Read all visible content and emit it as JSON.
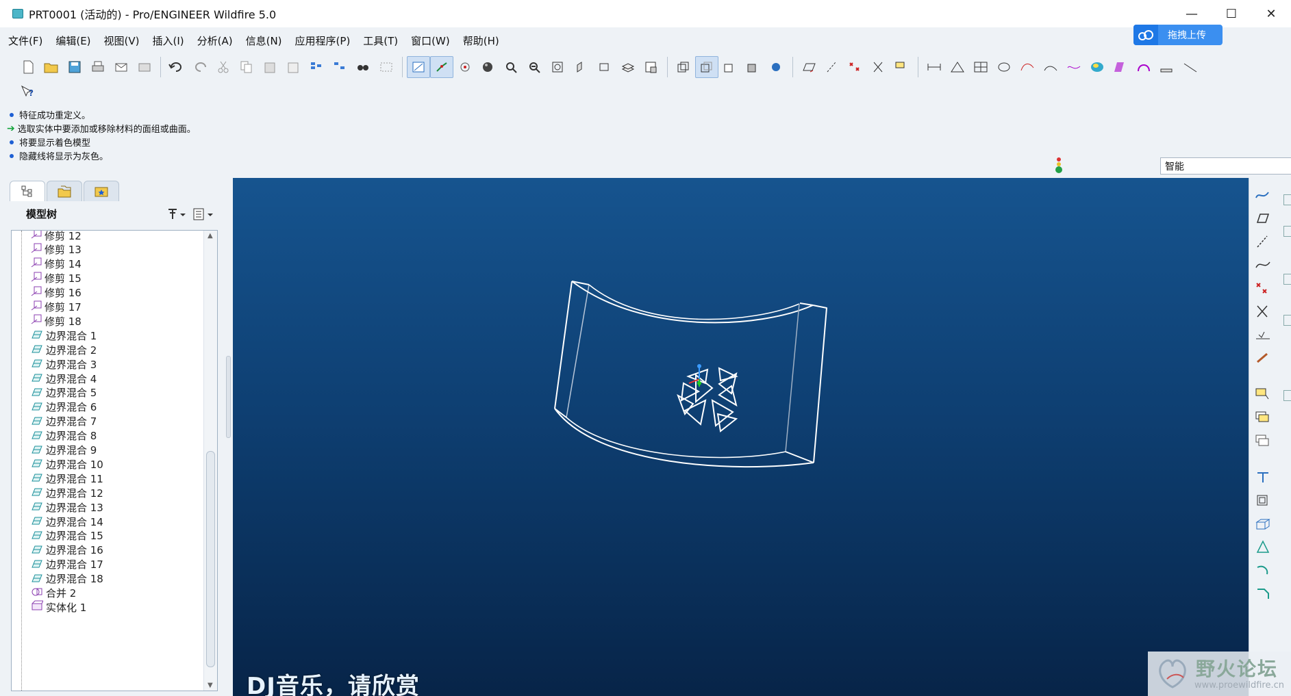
{
  "window": {
    "title": "PRT0001 (活动的) - Pro/ENGINEER Wildfire 5.0",
    "controls": [
      "—",
      "☐",
      "✕"
    ]
  },
  "menubar": {
    "items": [
      "文件(F)",
      "编辑(E)",
      "视图(V)",
      "插入(I)",
      "分析(A)",
      "信息(N)",
      "应用程序(P)",
      "工具(T)",
      "窗口(W)",
      "帮助(H)"
    ]
  },
  "cloud_upload": {
    "label": "拖拽上传"
  },
  "messages": [
    {
      "type": "info",
      "text": "特征成功重定义。"
    },
    {
      "type": "prompt",
      "text": "选取实体中要添加或移除材料的面组或曲面。"
    },
    {
      "type": "info",
      "text": "将要显示着色模型"
    },
    {
      "type": "info",
      "text": "隐藏线将显示为灰色。"
    }
  ],
  "selection_filter": {
    "value": "智能"
  },
  "model_tree": {
    "title": "模型树",
    "items": [
      {
        "icon": "trim-icon",
        "label": "修剪 12"
      },
      {
        "icon": "trim-icon",
        "label": "修剪 13"
      },
      {
        "icon": "trim-icon",
        "label": "修剪 14"
      },
      {
        "icon": "trim-icon",
        "label": "修剪 15"
      },
      {
        "icon": "trim-icon",
        "label": "修剪 16"
      },
      {
        "icon": "trim-icon",
        "label": "修剪 17"
      },
      {
        "icon": "trim-icon",
        "label": "修剪 18"
      },
      {
        "icon": "boundary-blend-icon",
        "label": "边界混合 1"
      },
      {
        "icon": "boundary-blend-icon",
        "label": "边界混合 2"
      },
      {
        "icon": "boundary-blend-icon",
        "label": "边界混合 3"
      },
      {
        "icon": "boundary-blend-icon",
        "label": "边界混合 4"
      },
      {
        "icon": "boundary-blend-icon",
        "label": "边界混合 5"
      },
      {
        "icon": "boundary-blend-icon",
        "label": "边界混合 6"
      },
      {
        "icon": "boundary-blend-icon",
        "label": "边界混合 7"
      },
      {
        "icon": "boundary-blend-icon",
        "label": "边界混合 8"
      },
      {
        "icon": "boundary-blend-icon",
        "label": "边界混合 9"
      },
      {
        "icon": "boundary-blend-icon",
        "label": "边界混合 10"
      },
      {
        "icon": "boundary-blend-icon",
        "label": "边界混合 11"
      },
      {
        "icon": "boundary-blend-icon",
        "label": "边界混合 12"
      },
      {
        "icon": "boundary-blend-icon",
        "label": "边界混合 13"
      },
      {
        "icon": "boundary-blend-icon",
        "label": "边界混合 14"
      },
      {
        "icon": "boundary-blend-icon",
        "label": "边界混合 15"
      },
      {
        "icon": "boundary-blend-icon",
        "label": "边界混合 16"
      },
      {
        "icon": "boundary-blend-icon",
        "label": "边界混合 17"
      },
      {
        "icon": "boundary-blend-icon",
        "label": "边界混合 18"
      },
      {
        "icon": "merge-icon",
        "label": "合并 2"
      },
      {
        "icon": "solidify-icon",
        "label": "实体化 1"
      }
    ]
  },
  "viewport": {
    "caption": "DJ音乐，请欣赏"
  },
  "watermark": {
    "title": "野火论坛",
    "url": "www.proewildfire.cn"
  },
  "colors": {
    "viewport_top": "#16548f",
    "viewport_bottom": "#072448",
    "accent": "#3b8ff0"
  }
}
